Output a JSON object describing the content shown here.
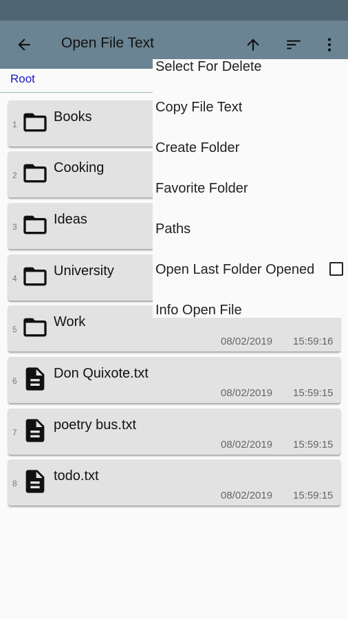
{
  "colors": {
    "status_bar": "#4f6471",
    "toolbar": "#6b8494",
    "breadcrumb": "#1a1ac4",
    "item_background": "#e2e2e2"
  },
  "toolbar": {
    "title": "Open File Text",
    "icons": [
      "back-arrow-icon",
      "arrow-up-icon",
      "sort-icon",
      "overflow-menu-icon"
    ]
  },
  "breadcrumb": {
    "label": "Root"
  },
  "items": [
    {
      "num": "1",
      "type": "folder",
      "name": "Books",
      "date": "",
      "time": ""
    },
    {
      "num": "2",
      "type": "folder",
      "name": "Cooking",
      "date": "",
      "time": ""
    },
    {
      "num": "3",
      "type": "folder",
      "name": "Ideas",
      "date": "",
      "time": ""
    },
    {
      "num": "4",
      "type": "folder",
      "name": "University",
      "date": "",
      "time": ""
    },
    {
      "num": "5",
      "type": "folder",
      "name": "Work",
      "date": "08/02/2019",
      "time": "15:59:16"
    },
    {
      "num": "6",
      "type": "file",
      "name": "Don Quixote.txt",
      "date": "08/02/2019",
      "time": "15:59:15"
    },
    {
      "num": "7",
      "type": "file",
      "name": "poetry bus.txt",
      "date": "08/02/2019",
      "time": "15:59:15"
    },
    {
      "num": "8",
      "type": "file",
      "name": "todo.txt",
      "date": "08/02/2019",
      "time": "15:59:15"
    }
  ],
  "menu": {
    "items": [
      "Select For Delete",
      "Copy File Text",
      "Create Folder",
      "Favorite Folder",
      "Paths",
      "Open Last Folder Opened",
      "Info Open File"
    ],
    "open_last_folder_checked": false
  }
}
